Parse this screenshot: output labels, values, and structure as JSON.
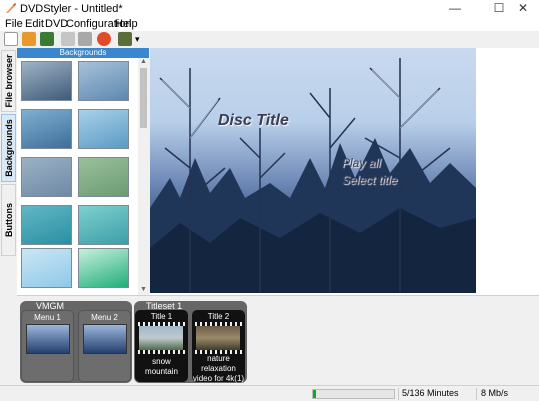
{
  "window": {
    "title": "DVDStyler - Untitled*",
    "minimize": "—",
    "maximize": "☐",
    "close": "✕"
  },
  "menu": [
    "File",
    "Edit",
    "DVD",
    "Configuration",
    "Help"
  ],
  "toolbar": {
    "buttons": [
      "new-icon",
      "open-icon",
      "save-icon",
      "settings-icon",
      "tools-icon",
      "burn-icon",
      "add-file-icon",
      "dropdown-icon"
    ],
    "dropdown_arrow": "▾"
  },
  "side_tabs": [
    "File browser",
    "Backgrounds",
    "Buttons"
  ],
  "backgrounds": {
    "header": "Backgrounds",
    "items": [
      {
        "name": "lake-landscape",
        "c1": "#3f5a7a",
        "c2": "#9fb3c6"
      },
      {
        "name": "coast-landscape",
        "c1": "#5e88b1",
        "c2": "#a7c2d9"
      },
      {
        "name": "island-water",
        "c1": "#3e6e9a",
        "c2": "#7fb0d1"
      },
      {
        "name": "blue-swirl",
        "c1": "#5a9bc5",
        "c2": "#a9d0e8"
      },
      {
        "name": "blue-gray-blur",
        "c1": "#6f8aa6",
        "c2": "#9bb1c5"
      },
      {
        "name": "green-blur",
        "c1": "#6c9b72",
        "c2": "#9ac09c"
      },
      {
        "name": "teal-stripes",
        "c1": "#2a8fa3",
        "c2": "#62b7c4"
      },
      {
        "name": "teal-glow",
        "c1": "#3d9ea7",
        "c2": "#7ed0cf"
      },
      {
        "name": "light-blue-frame",
        "c1": "#8fc8e8",
        "c2": "#cbe6f5"
      },
      {
        "name": "green-frame",
        "c1": "#1fae7a",
        "c2": "#c7f0dd"
      }
    ]
  },
  "preview": {
    "disc_title": "Disc Title",
    "buttons": [
      "Play all",
      "Select title"
    ]
  },
  "titleset_manager": {
    "vmgm_label": "VMGM",
    "titleset_label": "Titleset 1",
    "menus": [
      "Menu 1",
      "Menu 2"
    ],
    "titles": [
      {
        "label": "Title 1",
        "caption": "snow mountain"
      },
      {
        "label": "Title 2",
        "caption": "nature relaxation video for 4k(1)"
      }
    ]
  },
  "status": {
    "progress": 0.04,
    "duration": "5/136 Minutes",
    "bitrate": "8 Mb/s"
  }
}
